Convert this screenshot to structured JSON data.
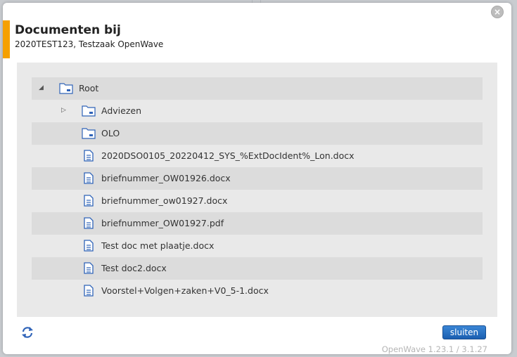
{
  "dialog": {
    "title": "Documenten bij",
    "subtitle": "2020TEST123, Testzaak OpenWave",
    "close_icon": "close-icon"
  },
  "tree": [
    {
      "label": "Root",
      "type": "folder",
      "toggle": "expanded",
      "shade": true
    },
    {
      "label": "Adviezen",
      "type": "folder",
      "toggle": "collapsed",
      "shade": false
    },
    {
      "label": "OLO",
      "type": "folder",
      "toggle": "none",
      "shade": true
    },
    {
      "label": "2020DSO0105_20220412_SYS_%ExtDocIdent%_Lon.docx",
      "type": "file",
      "shade": false
    },
    {
      "label": "briefnummer_OW01926.docx",
      "type": "file",
      "shade": true
    },
    {
      "label": "briefnummer_ow01927.docx",
      "type": "file",
      "shade": false
    },
    {
      "label": "briefnummer_OW01927.pdf",
      "type": "file",
      "shade": true
    },
    {
      "label": "Test doc met plaatje.docx",
      "type": "file",
      "shade": false
    },
    {
      "label": "Test doc2.docx",
      "type": "file",
      "shade": true
    },
    {
      "label": "Voorstel+Volgen+zaken+V0_5-1.docx",
      "type": "file",
      "shade": false
    }
  ],
  "footer": {
    "refresh_icon": "refresh-icon",
    "close_button_label": "sluiten",
    "version": "OpenWave 1.23.1 / 3.1.27"
  },
  "colors": {
    "accent": "#f5a000",
    "button": "#2a72c4",
    "icon_blue": "#2f63b8"
  }
}
